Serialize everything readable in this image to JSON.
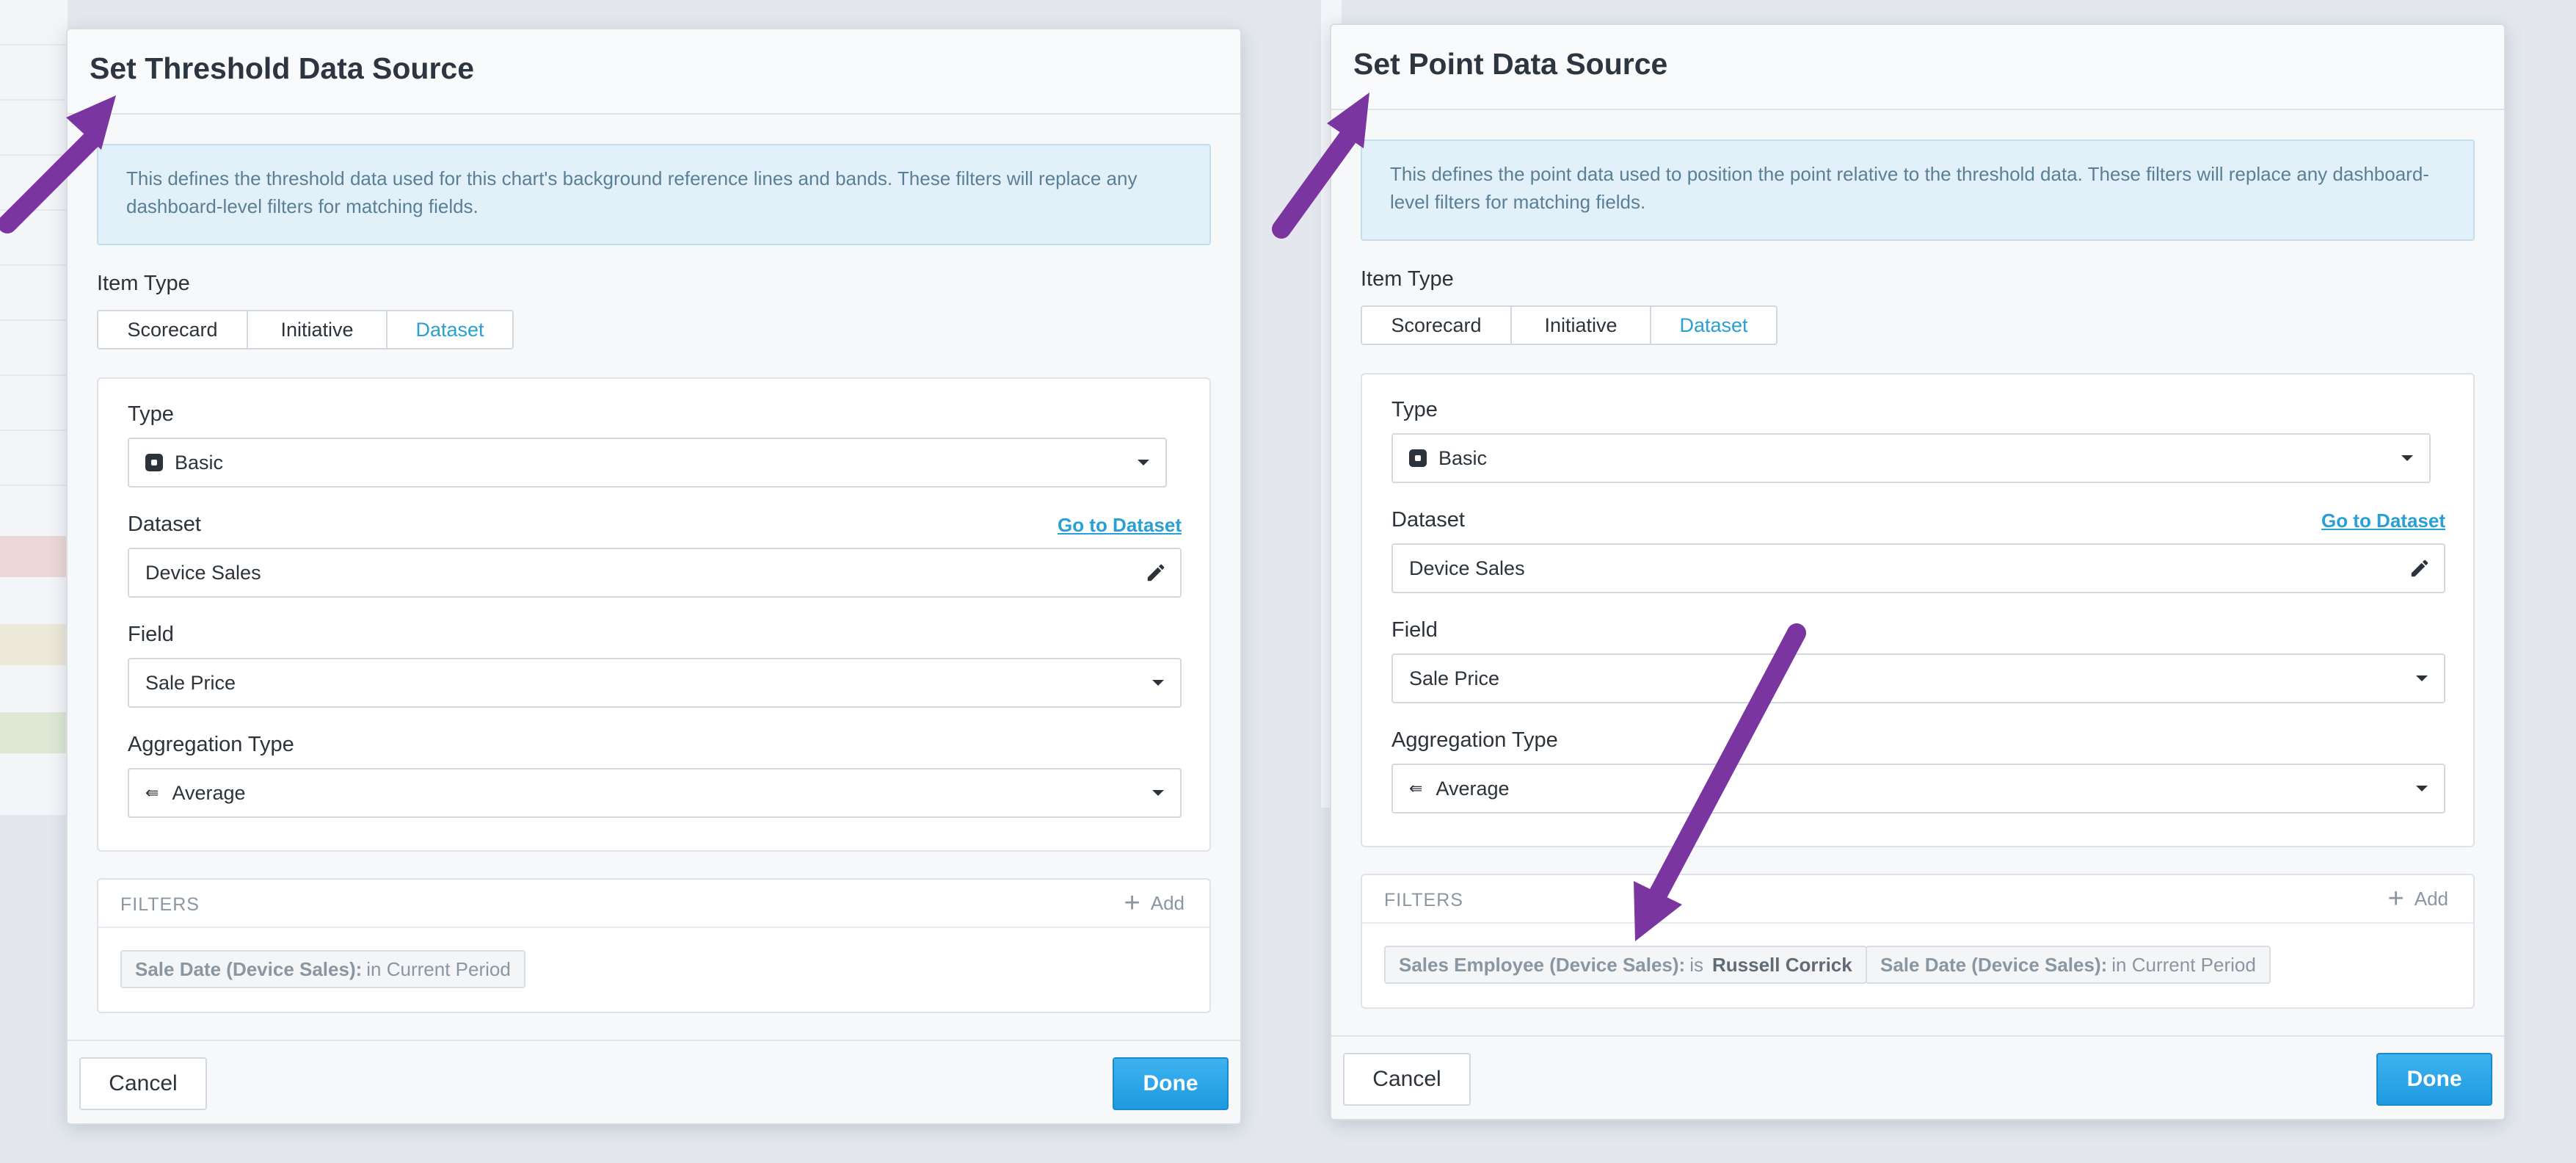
{
  "dialogs": [
    {
      "title": "Set Threshold Data Source",
      "info": "This defines the threshold data used for this chart's background reference lines and bands. These filters will replace any dashboard-level filters for matching fields.",
      "item_type_label": "Item Type",
      "item_types": [
        "Scorecard",
        "Initiative",
        "Dataset"
      ],
      "active_item_type": "Dataset",
      "type_label": "Type",
      "type_value": "Basic",
      "dataset_label": "Dataset",
      "dataset_link": "Go to Dataset",
      "dataset_value": "Device Sales",
      "field_label": "Field",
      "field_value": "Sale Price",
      "aggregation_label": "Aggregation Type",
      "aggregation_value": "Average",
      "filters_title": "FILTERS",
      "add_label": "Add",
      "filters": [
        {
          "key": "Sale Date (Device Sales):",
          "op": "in Current Period",
          "value": ""
        }
      ],
      "cancel_label": "Cancel",
      "done_label": "Done"
    },
    {
      "title": "Set Point Data Source",
      "info": "This defines the point data used to position the point relative to the threshold data. These filters will replace any dashboard-level filters for matching fields.",
      "item_type_label": "Item Type",
      "item_types": [
        "Scorecard",
        "Initiative",
        "Dataset"
      ],
      "active_item_type": "Dataset",
      "type_label": "Type",
      "type_value": "Basic",
      "dataset_label": "Dataset",
      "dataset_link": "Go to Dataset",
      "dataset_value": "Device Sales",
      "field_label": "Field",
      "field_value": "Sale Price",
      "aggregation_label": "Aggregation Type",
      "aggregation_value": "Average",
      "filters_title": "FILTERS",
      "add_label": "Add",
      "filters": [
        {
          "key": "Sales Employee (Device Sales):",
          "op": "is",
          "value": "Russell Corrick"
        },
        {
          "key": "Sale Date (Device Sales):",
          "op": "in Current Period",
          "value": ""
        }
      ],
      "cancel_label": "Cancel",
      "done_label": "Done"
    }
  ],
  "colors": {
    "accent": "#2a9fd4",
    "done_button": "#2aa7ea",
    "info_bg": "#e2f1f9",
    "annotation_arrow": "#7b35a0"
  },
  "icons": [
    "basic-type-icon",
    "pencil-icon",
    "average-icon",
    "plus-icon",
    "chevron-down-icon",
    "annotation-arrow"
  ]
}
